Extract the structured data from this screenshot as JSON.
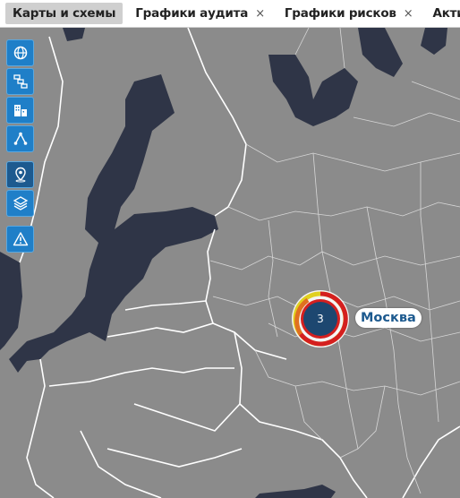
{
  "tabs": [
    {
      "label": "Карты и схемы",
      "active": true,
      "closable": false
    },
    {
      "label": "Графики аудита",
      "active": false,
      "closable": true
    },
    {
      "label": "Графики рисков",
      "active": false,
      "closable": true
    },
    {
      "label": "Активы",
      "active": false,
      "closable": true
    }
  ],
  "close_glyph": "×",
  "toolbar": {
    "tools": [
      "globe-icon",
      "hierarchy-icon",
      "buildings-icon",
      "network-icon",
      "location-pin-icon",
      "layers-icon",
      "warning-icon"
    ]
  },
  "marker": {
    "count": "3",
    "city": "Москва"
  },
  "colors": {
    "sea": "#2f3547",
    "land": "#8b8b8b",
    "border": "#ffffff",
    "toolbar_blue": "#1f7fc8",
    "marker_fill": "#1d4770",
    "marker_ring_red": "#d41f1f",
    "marker_ring_yellow": "#e0d020",
    "label_text": "#1d5a8f"
  }
}
